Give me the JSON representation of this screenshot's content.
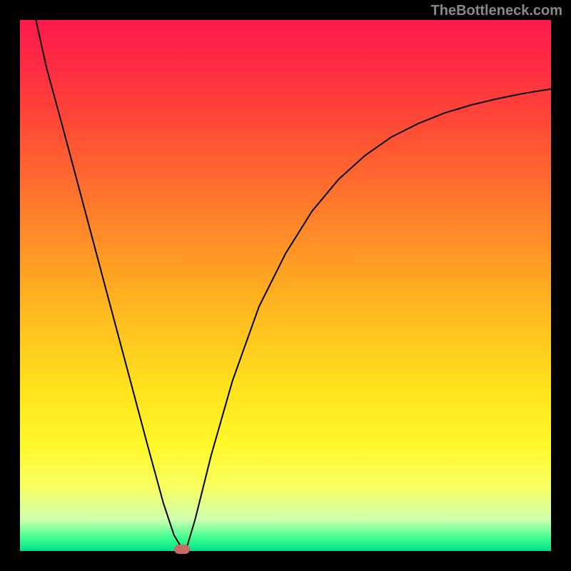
{
  "watermark": "TheBottleneck.com",
  "chart_data": {
    "type": "line",
    "title": "",
    "xlabel": "",
    "ylabel": "",
    "xlim": [
      0,
      100
    ],
    "ylim": [
      0,
      100
    ],
    "series": [
      {
        "name": "bottleneck-curve",
        "x": [
          3,
          5,
          8,
          12,
          16,
          20,
          24,
          27,
          29,
          30.5,
          31.5,
          33,
          36,
          40,
          45,
          50,
          55,
          60,
          65,
          70,
          75,
          80,
          85,
          90,
          95,
          100
        ],
        "values": [
          100,
          91,
          80,
          65,
          50,
          35,
          20,
          9,
          3,
          0.5,
          1,
          6,
          18,
          32,
          46,
          56,
          64,
          70,
          74.5,
          78,
          80.5,
          82.5,
          84,
          85.2,
          86.2,
          87
        ]
      }
    ],
    "marker": {
      "x": 30.5,
      "y": 0.4,
      "label": "optimal-point"
    },
    "background_gradient": {
      "stops": [
        {
          "pos": 0.0,
          "color": "#ff1a4d"
        },
        {
          "pos": 0.5,
          "color": "#ffaa22"
        },
        {
          "pos": 0.8,
          "color": "#fff82a"
        },
        {
          "pos": 1.0,
          "color": "#00e088"
        }
      ]
    }
  }
}
